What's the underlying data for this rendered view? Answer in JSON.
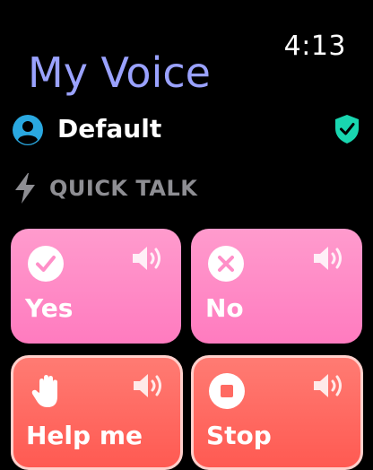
{
  "status": {
    "time": "4:13"
  },
  "header": {
    "title": "My Voice"
  },
  "profile": {
    "name": "Default",
    "avatar_icon": "person-circle-icon",
    "badge_icon": "shield-check-icon",
    "badge_color": "#19d6b0"
  },
  "section": {
    "label": "QUICK TALK",
    "icon": "bolt-icon"
  },
  "tiles": [
    {
      "label": "Yes",
      "icon": "checkmark-circle-icon",
      "color": "#ff8fc8"
    },
    {
      "label": "No",
      "icon": "x-circle-icon",
      "color": "#ff8fc8"
    },
    {
      "label": "Help me",
      "icon": "raised-hand-icon",
      "color": "#ff6a62"
    },
    {
      "label": "Stop",
      "icon": "stop-circle-icon",
      "color": "#ff6a62"
    }
  ]
}
